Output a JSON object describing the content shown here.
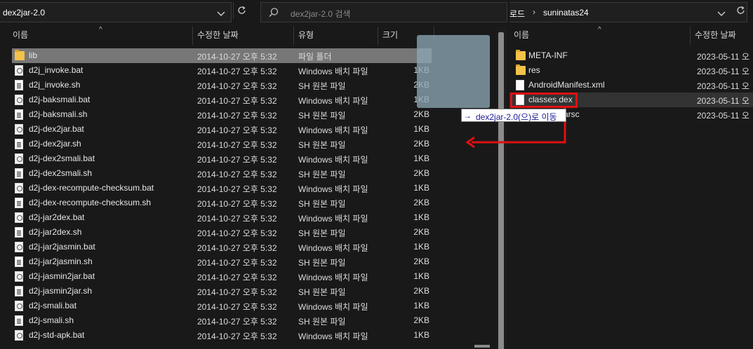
{
  "left": {
    "address": "dex2jar-2.0",
    "search_placeholder": "dex2jar-2.0 검색",
    "columns": {
      "name": "이름",
      "date": "수정한 날짜",
      "type": "유형",
      "size": "크기"
    },
    "files": [
      {
        "name": "lib",
        "date": "2014-10-27 오후 5:32",
        "type": "파일 폴더",
        "size": "",
        "icon": "folder-icon"
      },
      {
        "name": "d2j_invoke.bat",
        "date": "2014-10-27 오후 5:32",
        "type": "Windows 배치 파일",
        "size": "1KB",
        "icon": "bat-file-icon"
      },
      {
        "name": "d2j_invoke.sh",
        "date": "2014-10-27 오후 5:32",
        "type": "SH 원본 파일",
        "size": "2KB",
        "icon": "sh-file-icon"
      },
      {
        "name": "d2j-baksmali.bat",
        "date": "2014-10-27 오후 5:32",
        "type": "Windows 배치 파일",
        "size": "1KB",
        "icon": "bat-file-icon"
      },
      {
        "name": "d2j-baksmali.sh",
        "date": "2014-10-27 오후 5:32",
        "type": "SH 원본 파일",
        "size": "2KB",
        "icon": "sh-file-icon"
      },
      {
        "name": "d2j-dex2jar.bat",
        "date": "2014-10-27 오후 5:32",
        "type": "Windows 배치 파일",
        "size": "1KB",
        "icon": "bat-file-icon"
      },
      {
        "name": "d2j-dex2jar.sh",
        "date": "2014-10-27 오후 5:32",
        "type": "SH 원본 파일",
        "size": "2KB",
        "icon": "sh-file-icon"
      },
      {
        "name": "d2j-dex2smali.bat",
        "date": "2014-10-27 오후 5:32",
        "type": "Windows 배치 파일",
        "size": "1KB",
        "icon": "bat-file-icon"
      },
      {
        "name": "d2j-dex2smali.sh",
        "date": "2014-10-27 오후 5:32",
        "type": "SH 원본 파일",
        "size": "2KB",
        "icon": "sh-file-icon"
      },
      {
        "name": "d2j-dex-recompute-checksum.bat",
        "date": "2014-10-27 오후 5:32",
        "type": "Windows 배치 파일",
        "size": "1KB",
        "icon": "bat-file-icon"
      },
      {
        "name": "d2j-dex-recompute-checksum.sh",
        "date": "2014-10-27 오후 5:32",
        "type": "SH 원본 파일",
        "size": "2KB",
        "icon": "sh-file-icon"
      },
      {
        "name": "d2j-jar2dex.bat",
        "date": "2014-10-27 오후 5:32",
        "type": "Windows 배치 파일",
        "size": "1KB",
        "icon": "bat-file-icon"
      },
      {
        "name": "d2j-jar2dex.sh",
        "date": "2014-10-27 오후 5:32",
        "type": "SH 원본 파일",
        "size": "2KB",
        "icon": "sh-file-icon"
      },
      {
        "name": "d2j-jar2jasmin.bat",
        "date": "2014-10-27 오후 5:32",
        "type": "Windows 배치 파일",
        "size": "1KB",
        "icon": "bat-file-icon"
      },
      {
        "name": "d2j-jar2jasmin.sh",
        "date": "2014-10-27 오후 5:32",
        "type": "SH 원본 파일",
        "size": "2KB",
        "icon": "sh-file-icon"
      },
      {
        "name": "d2j-jasmin2jar.bat",
        "date": "2014-10-27 오후 5:32",
        "type": "Windows 배치 파일",
        "size": "1KB",
        "icon": "bat-file-icon"
      },
      {
        "name": "d2j-jasmin2jar.sh",
        "date": "2014-10-27 오후 5:32",
        "type": "SH 원본 파일",
        "size": "2KB",
        "icon": "sh-file-icon"
      },
      {
        "name": "d2j-smali.bat",
        "date": "2014-10-27 오후 5:32",
        "type": "Windows 배치 파일",
        "size": "1KB",
        "icon": "bat-file-icon"
      },
      {
        "name": "d2j-smali.sh",
        "date": "2014-10-27 오후 5:32",
        "type": "SH 원본 파일",
        "size": "2KB",
        "icon": "sh-file-icon"
      },
      {
        "name": "d2j-std-apk.bat",
        "date": "2014-10-27 오후 5:32",
        "type": "Windows 배치 파일",
        "size": "1KB",
        "icon": "bat-file-icon"
      }
    ],
    "selected_index": 0
  },
  "drag_tooltip": {
    "arrow": "→",
    "text": "dex2jar-2.0(으)로 이동"
  },
  "right": {
    "breadcrumb": [
      "로드",
      "suninatas24"
    ],
    "breadcrumb_separator": "›",
    "columns": {
      "name": "이름",
      "date": "수정한 날짜"
    },
    "files": [
      {
        "name": "META-INF",
        "date": "2023-05-11 오",
        "icon": "folder-icon"
      },
      {
        "name": "res",
        "date": "2023-05-11 오",
        "icon": "folder-icon"
      },
      {
        "name": "AndroidManifest.xml",
        "date": "2023-05-11 오",
        "icon": "file-icon"
      },
      {
        "name": "classes.dex",
        "date": "2023-05-11 오",
        "icon": "file-icon"
      },
      {
        "name": "arsc",
        "date": "2023-05-11 오",
        "icon": "file-icon"
      }
    ],
    "selected_index": 3
  },
  "annotation": {
    "color": "#e01010"
  }
}
